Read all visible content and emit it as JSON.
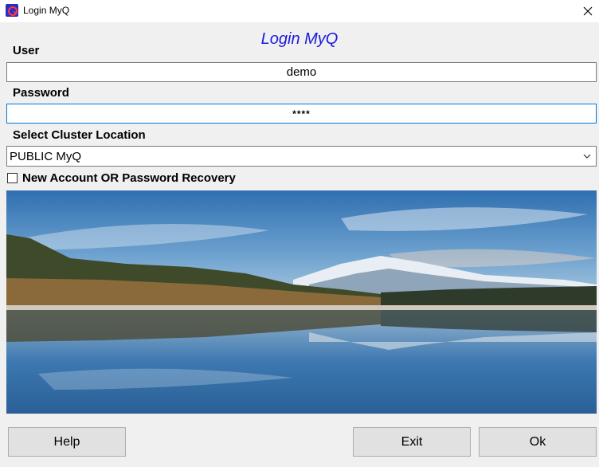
{
  "window": {
    "title": "Login MyQ",
    "app_icon": "myq-logo-icon",
    "close_icon": "close-icon"
  },
  "heading": "Login MyQ",
  "user": {
    "label": "User",
    "value": "demo"
  },
  "password": {
    "label": "Password",
    "value": "****"
  },
  "cluster": {
    "label": "Select Cluster Location",
    "selected": "PUBLIC MyQ"
  },
  "recovery": {
    "label": "New Account OR Password Recovery",
    "checked": false
  },
  "photo": {
    "subject": "mountain-lake-landscape"
  },
  "buttons": {
    "help": "Help",
    "exit": "Exit",
    "ok": "Ok"
  },
  "colors": {
    "heading": "#1a1adf",
    "focus_border": "#0078d7",
    "window_bg": "#f0f0f0",
    "button_bg": "#e1e1e1"
  }
}
